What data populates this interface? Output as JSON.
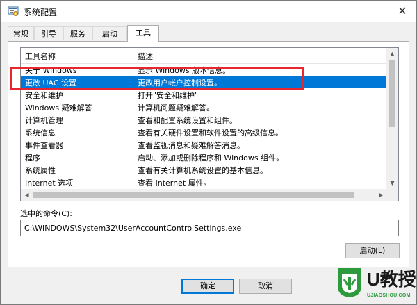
{
  "window": {
    "title": "系统配置",
    "icon": "msconfig-icon",
    "close_glyph": "✕"
  },
  "tabs": [
    {
      "label": "常规",
      "active": false
    },
    {
      "label": "引导",
      "active": false
    },
    {
      "label": "服务",
      "active": false
    },
    {
      "label": "启动",
      "active": false
    },
    {
      "label": "工具",
      "active": true
    }
  ],
  "tools_list": {
    "columns": [
      "工具名称",
      "描述"
    ],
    "rows": [
      {
        "name": "关于 Windows",
        "desc": "显示 Windows 版本信息。"
      },
      {
        "name": "更改 UAC 设置",
        "desc": "更改用户帐户控制设置。",
        "selected": true
      },
      {
        "name": "安全和维护",
        "desc": "打开\"安全和维护\""
      },
      {
        "name": "Windows 疑难解答",
        "desc": "计算机问题疑难解答。"
      },
      {
        "name": "计算机管理",
        "desc": "查看和配置系统设置和组件。"
      },
      {
        "name": "系统信息",
        "desc": "查看有关硬件设置和软件设置的高级信息。"
      },
      {
        "name": "事件查看器",
        "desc": "查看监视消息和疑难解答消息。"
      },
      {
        "name": "程序",
        "desc": "启动、添加或删除程序和 Windows 组件。"
      },
      {
        "name": "系统属性",
        "desc": "查看有关计算机系统设置的基本信息。"
      },
      {
        "name": "Internet 选项",
        "desc": "查看 Internet 属性。"
      }
    ]
  },
  "command": {
    "label": "选中的命令(C):",
    "value": "C:\\WINDOWS\\System32\\UserAccountControlSettings.exe"
  },
  "buttons": {
    "launch": "启动(L)",
    "ok": "确定",
    "cancel": "取消"
  },
  "watermark": {
    "brand": "U教授",
    "url": "UJIAOSHOU.COM"
  },
  "colors": {
    "selection": "#0078d7",
    "highlight_box": "#e8262d",
    "watermark_green": "#2e9a3e"
  }
}
